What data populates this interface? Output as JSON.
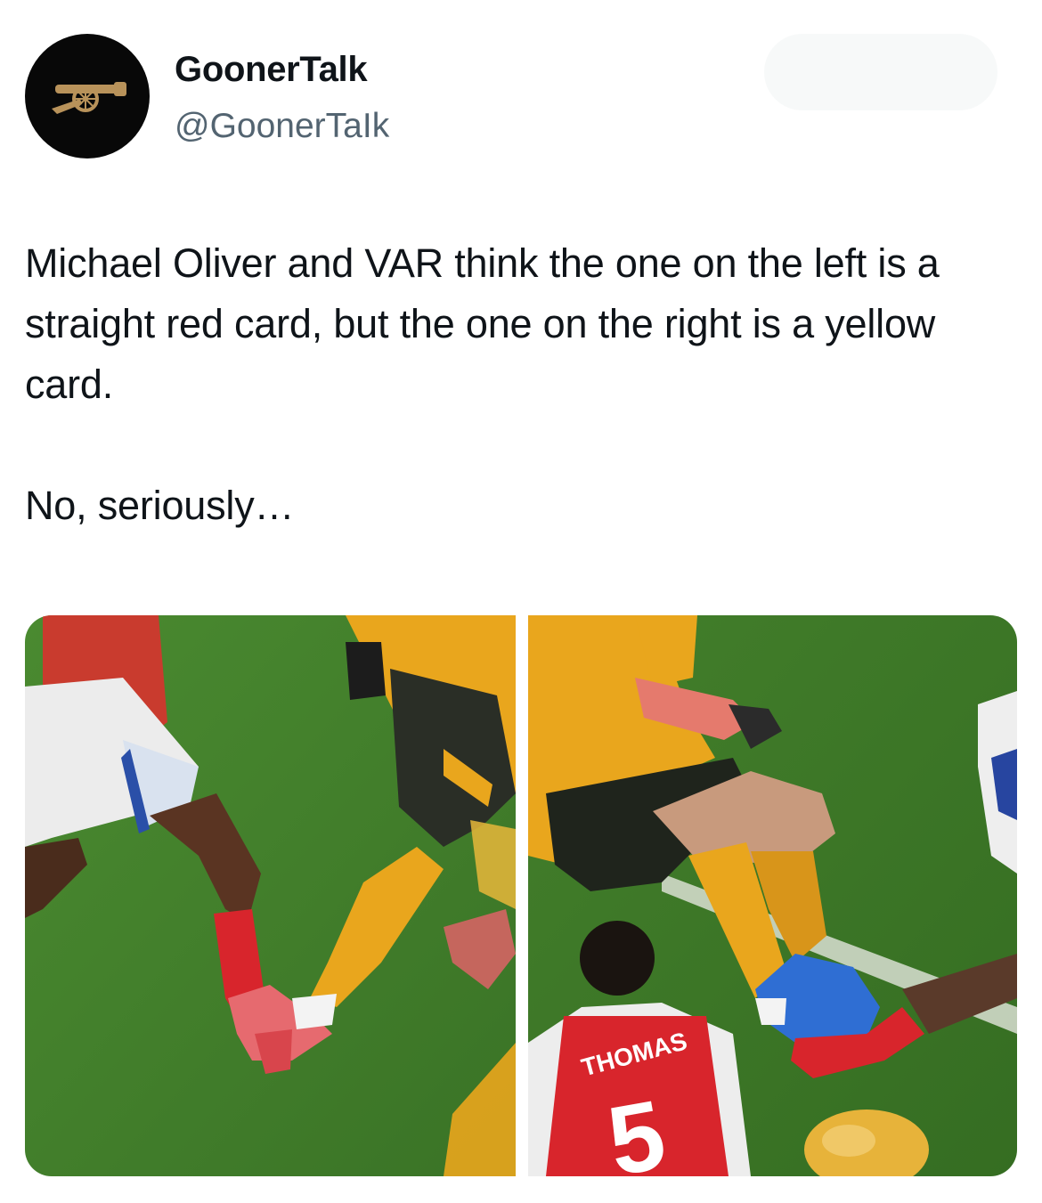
{
  "author": {
    "name": "GoonerTalk",
    "handle": "@GoonerTaIk",
    "avatar_icon": "cannon-icon"
  },
  "tweet": {
    "paragraphs": [
      "Michael Oliver and VAR think the one on the left is a straight red card, but the one on the right is a yellow card.",
      "No, seriously…"
    ]
  },
  "media": {
    "left_image": "tackle-image-left",
    "right_image": "tackle-image-right",
    "shirt_name": "THOMAS",
    "shirt_number": "5"
  },
  "colors": {
    "pitch": "#3f7d2a",
    "arsenal_red": "#d8252c",
    "wolves_gold": "#e9a61d",
    "text_primary": "#0f1419",
    "text_secondary": "#536471",
    "avatar_bg": "#080808",
    "cannon_gold": "#b8925a"
  }
}
